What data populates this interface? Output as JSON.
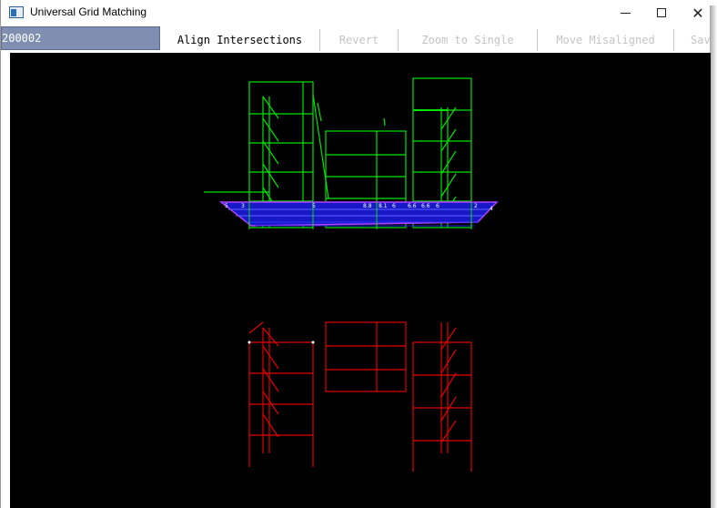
{
  "window": {
    "title": "Universal Grid Matching",
    "controls": {
      "minimize": "–",
      "maximize": "☐",
      "close": "✕"
    }
  },
  "toolbar": {
    "id_value": "200002",
    "buttons": [
      {
        "label": "Align Intersections",
        "enabled": true
      },
      {
        "label": "Revert",
        "enabled": false
      },
      {
        "label": "Zoom to Single",
        "enabled": false
      },
      {
        "label": "Move Misaligned",
        "enabled": false
      },
      {
        "label": "Sav",
        "enabled": false
      }
    ]
  },
  "viewport": {
    "background": "#000000",
    "colors": {
      "upper_grid": "#00e400",
      "lower_grid": "#e00000",
      "base_fill": "#1818c8",
      "base_edge": "#b040ff",
      "labels": "#ffffff"
    },
    "upper_labels": [
      "5",
      "3",
      "5",
      "8.8",
      "8.1",
      "6",
      "6.6",
      "6.6",
      "6",
      "2",
      "4"
    ]
  }
}
